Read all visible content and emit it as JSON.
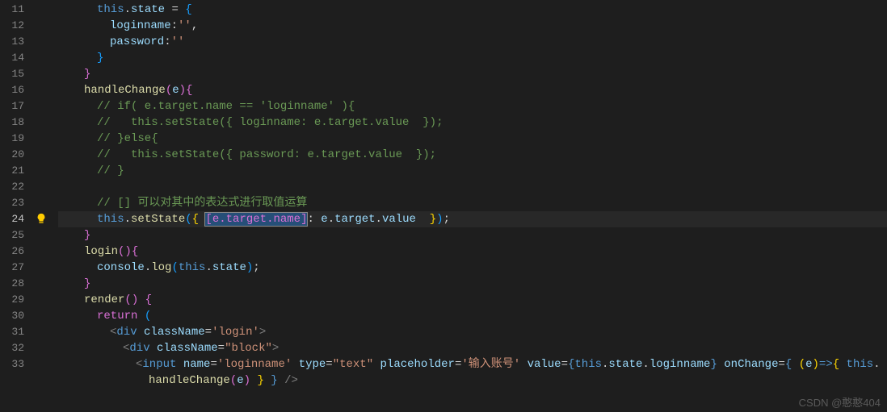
{
  "editor": {
    "first_line": 11,
    "active_line": 24,
    "watermark": "CSDN @憨憨404"
  },
  "lines": {
    "l11": {
      "num": "11",
      "indent": 3,
      "raw": "this.state = {",
      "tokens": [
        [
          "t-blue",
          "this"
        ],
        [
          "t-white",
          "."
        ],
        [
          "t-lblue",
          "state"
        ],
        [
          "t-white",
          " "
        ],
        [
          "t-white",
          "="
        ],
        [
          "t-white",
          " "
        ],
        [
          "t-brace-b",
          "{"
        ]
      ]
    },
    "l12": {
      "num": "12",
      "indent": 4,
      "raw": "loginname:'',",
      "tokens": [
        [
          "t-lblue",
          "loginname"
        ],
        [
          "t-white",
          ":"
        ],
        [
          "t-orange",
          "''"
        ],
        [
          "t-white",
          ","
        ]
      ]
    },
    "l13": {
      "num": "13",
      "indent": 4,
      "raw": "password:''",
      "tokens": [
        [
          "t-lblue",
          "password"
        ],
        [
          "t-white",
          ":"
        ],
        [
          "t-orange",
          "''"
        ]
      ]
    },
    "l14": {
      "num": "14",
      "indent": 3,
      "raw": "}",
      "tokens": [
        [
          "t-brace-b",
          "}"
        ]
      ]
    },
    "l15": {
      "num": "15",
      "indent": 2,
      "raw": "}",
      "tokens": [
        [
          "t-brace-p",
          "}"
        ]
      ]
    },
    "l16": {
      "num": "16",
      "indent": 2,
      "raw": "handleChange(e){",
      "tokens": [
        [
          "t-yellow",
          "handleChange"
        ],
        [
          "t-brace-p",
          "("
        ],
        [
          "t-lblue",
          "e"
        ],
        [
          "t-brace-p",
          ")"
        ],
        [
          "t-brace-p",
          "{"
        ]
      ]
    },
    "l17": {
      "num": "17",
      "indent": 3,
      "raw": "// if( e.target.name == 'loginname' ){",
      "tokens": [
        [
          "t-green",
          "// if( e.target.name == 'loginname' ){"
        ]
      ]
    },
    "l18": {
      "num": "18",
      "indent": 3,
      "raw": "//   this.setState({ loginname: e.target.value  });",
      "tokens": [
        [
          "t-green",
          "//   this.setState({ loginname: e.target.value  });"
        ]
      ]
    },
    "l19": {
      "num": "19",
      "indent": 3,
      "raw": "// }else{",
      "tokens": [
        [
          "t-green",
          "// }else{"
        ]
      ]
    },
    "l20": {
      "num": "20",
      "indent": 3,
      "raw": "//   this.setState({ password: e.target.value  });",
      "tokens": [
        [
          "t-green",
          "//   this.setState({ password: e.target.value  });"
        ]
      ]
    },
    "l21": {
      "num": "21",
      "indent": 3,
      "raw": "// }",
      "tokens": [
        [
          "t-green",
          "// }"
        ]
      ]
    },
    "l22": {
      "num": "22",
      "indent": 0,
      "raw": "",
      "tokens": []
    },
    "l23": {
      "num": "23",
      "indent": 3,
      "raw": "// [] 可以对其中的表达式进行取值运算",
      "tokens": [
        [
          "t-green",
          "// [] 可以对其中的表达式进行取值运算"
        ]
      ]
    },
    "l24": {
      "num": "24",
      "indent": 3,
      "raw": "this.setState({ [e.target.name]: e.target.value  });",
      "tokens": [
        [
          "t-blue",
          "this"
        ],
        [
          "t-white",
          "."
        ],
        [
          "t-yellow",
          "setState"
        ],
        [
          "t-brace-b",
          "("
        ],
        [
          "t-brace-y",
          "{"
        ],
        [
          "t-white",
          " "
        ],
        [
          "t-brace-p sel",
          "[e.target.name]"
        ],
        [
          "t-white",
          ": "
        ],
        [
          "t-lblue",
          "e"
        ],
        [
          "t-white",
          "."
        ],
        [
          "t-lblue",
          "target"
        ],
        [
          "t-white",
          "."
        ],
        [
          "t-lblue",
          "value"
        ],
        [
          "t-white",
          "  "
        ],
        [
          "t-brace-y",
          "}"
        ],
        [
          "t-brace-b",
          ")"
        ],
        [
          "t-white",
          ";"
        ]
      ]
    },
    "l25": {
      "num": "25",
      "indent": 2,
      "raw": "}",
      "tokens": [
        [
          "t-brace-p",
          "}"
        ]
      ]
    },
    "l26": {
      "num": "26",
      "indent": 2,
      "raw": "login(){",
      "tokens": [
        [
          "t-yellow",
          "login"
        ],
        [
          "t-brace-p",
          "("
        ],
        [
          "t-brace-p",
          ")"
        ],
        [
          "t-brace-p",
          "{"
        ]
      ]
    },
    "l27": {
      "num": "27",
      "indent": 3,
      "raw": "console.log(this.state);",
      "tokens": [
        [
          "t-lblue",
          "console"
        ],
        [
          "t-white",
          "."
        ],
        [
          "t-yellow",
          "log"
        ],
        [
          "t-brace-b",
          "("
        ],
        [
          "t-blue",
          "this"
        ],
        [
          "t-white",
          "."
        ],
        [
          "t-lblue",
          "state"
        ],
        [
          "t-brace-b",
          ")"
        ],
        [
          "t-white",
          ";"
        ]
      ]
    },
    "l28": {
      "num": "28",
      "indent": 2,
      "raw": "}",
      "tokens": [
        [
          "t-brace-p",
          "}"
        ]
      ]
    },
    "l29": {
      "num": "29",
      "indent": 2,
      "raw": "render() {",
      "tokens": [
        [
          "t-yellow",
          "render"
        ],
        [
          "t-brace-p",
          "("
        ],
        [
          "t-brace-p",
          ")"
        ],
        [
          "t-white",
          " "
        ],
        [
          "t-brace-p",
          "{"
        ]
      ]
    },
    "l30": {
      "num": "30",
      "indent": 3,
      "raw": "return (",
      "tokens": [
        [
          "t-brace-p",
          "return"
        ],
        [
          "t-white",
          " "
        ],
        [
          "t-brace-b",
          "("
        ]
      ]
    },
    "l31": {
      "num": "31",
      "indent": 4,
      "raw": "<div className='login'>",
      "tokens": [
        [
          "t-tag",
          "<"
        ],
        [
          "t-blue",
          "div"
        ],
        [
          "t-white",
          " "
        ],
        [
          "t-attr",
          "className"
        ],
        [
          "t-white",
          "="
        ],
        [
          "t-orange",
          "'login'"
        ],
        [
          "t-tag",
          ">"
        ]
      ]
    },
    "l32": {
      "num": "32",
      "indent": 5,
      "raw": "<div className=\"block\">",
      "tokens": [
        [
          "t-tag",
          "<"
        ],
        [
          "t-blue",
          "div"
        ],
        [
          "t-white",
          " "
        ],
        [
          "t-attr",
          "className"
        ],
        [
          "t-white",
          "="
        ],
        [
          "t-orange",
          "\"block\""
        ],
        [
          "t-tag",
          ">"
        ]
      ]
    },
    "l33": {
      "num": "33",
      "indent": 6,
      "raw": "<input name='loginname' type=\"text\" placeholder='输入账号' value={this.state.loginname} onChange={ (e)=>{ this.",
      "tokens": [
        [
          "t-tag",
          "<"
        ],
        [
          "t-blue",
          "input"
        ],
        [
          "t-white",
          " "
        ],
        [
          "t-attr",
          "name"
        ],
        [
          "t-white",
          "="
        ],
        [
          "t-orange",
          "'loginname'"
        ],
        [
          "t-white",
          " "
        ],
        [
          "t-attr",
          "type"
        ],
        [
          "t-white",
          "="
        ],
        [
          "t-orange",
          "\"text\""
        ],
        [
          "t-white",
          " "
        ],
        [
          "t-attr",
          "placeholder"
        ],
        [
          "t-white",
          "="
        ],
        [
          "t-orange",
          "'输入账号'"
        ],
        [
          "t-white",
          " "
        ],
        [
          "t-attr",
          "value"
        ],
        [
          "t-white",
          "="
        ],
        [
          "t-blue",
          "{"
        ],
        [
          "t-blue",
          "this"
        ],
        [
          "t-white",
          "."
        ],
        [
          "t-lblue",
          "state"
        ],
        [
          "t-white",
          "."
        ],
        [
          "t-lblue",
          "loginname"
        ],
        [
          "t-blue",
          "}"
        ],
        [
          "t-white",
          " "
        ],
        [
          "t-attr",
          "onChange"
        ],
        [
          "t-white",
          "="
        ],
        [
          "t-blue",
          "{"
        ],
        [
          "t-white",
          " "
        ],
        [
          "t-brace-y",
          "("
        ],
        [
          "t-lblue",
          "e"
        ],
        [
          "t-brace-y",
          ")"
        ],
        [
          "t-blue",
          "=>"
        ],
        [
          "t-brace-y",
          "{"
        ],
        [
          "t-white",
          " "
        ],
        [
          "t-blue",
          "this"
        ],
        [
          "t-white",
          "."
        ]
      ]
    },
    "l34": {
      "num": "",
      "indent": 0,
      "raw": "handleChange(e) } } />",
      "tokens": [
        [
          "t-yellow",
          "handleChange"
        ],
        [
          "t-brace-p",
          "("
        ],
        [
          "t-lblue",
          "e"
        ],
        [
          "t-brace-p",
          ")"
        ],
        [
          "t-white",
          " "
        ],
        [
          "t-brace-y",
          "}"
        ],
        [
          "t-white",
          " "
        ],
        [
          "t-blue",
          "}"
        ],
        [
          "t-white",
          " "
        ],
        [
          "t-tag",
          "/>"
        ]
      ]
    }
  }
}
